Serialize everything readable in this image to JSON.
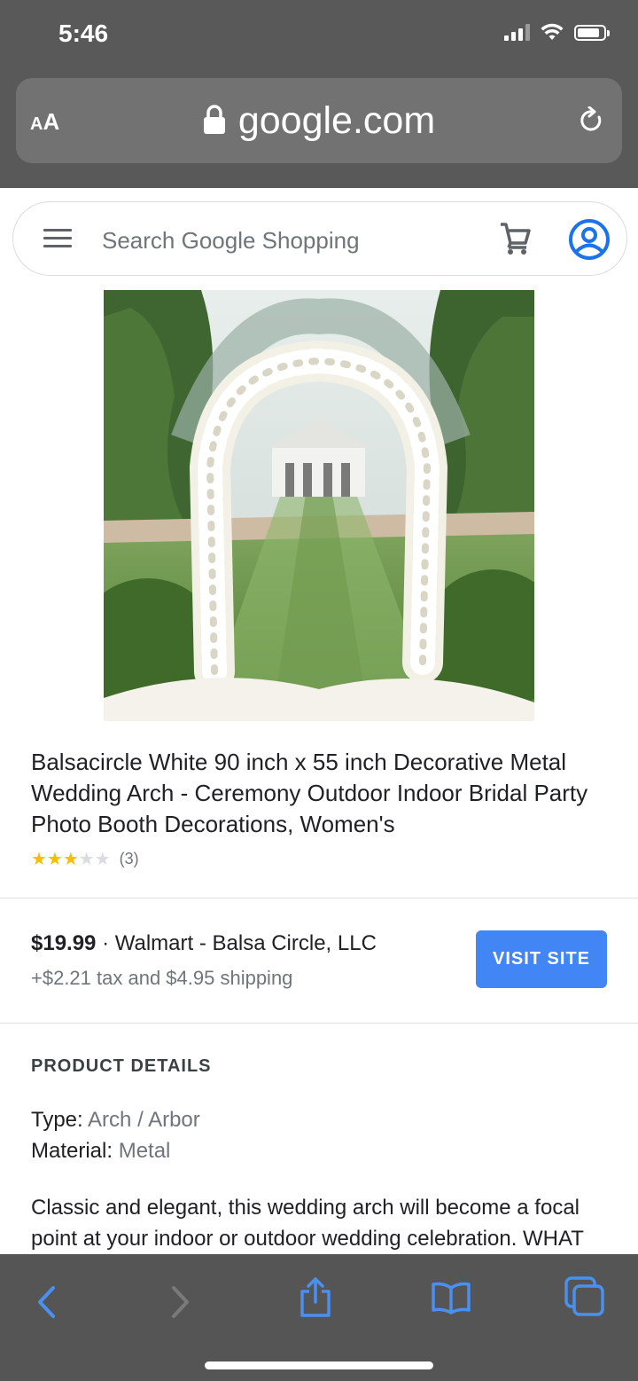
{
  "status_bar": {
    "time": "5:46"
  },
  "browser": {
    "aa_small": "A",
    "aa_big": "A",
    "domain": "google.com"
  },
  "search": {
    "placeholder": "Search Google Shopping"
  },
  "product": {
    "title": "Balsacircle White 90 inch x 55 inch Decorative Metal Wedding Arch - Ceremony Outdoor Indoor Bridal Party Photo Booth Decorations, Women's",
    "rating": 3,
    "rating_max": 5,
    "stars_filled": "★★★",
    "stars_empty": "★★",
    "review_count": "(3)"
  },
  "offer": {
    "price": "$19.99",
    "separator": " · ",
    "seller": "Walmart - Balsa Circle, LLC",
    "shipping": "+$2.21 tax and $4.95 shipping",
    "visit_label": "VISIT SITE",
    "accent_color": "#4285f4"
  },
  "details": {
    "heading": "PRODUCT DETAILS",
    "type_label": "Type:",
    "type_value": "Arch / Arbor",
    "material_label": "Material:",
    "material_value": "Metal",
    "description": "Classic and elegant, this wedding arch will become a focal point at your indoor or outdoor wedding celebration. WHAT"
  },
  "toolbar": {
    "icons": [
      "back-icon",
      "forward-icon",
      "share-icon",
      "bookmarks-icon",
      "tabs-icon"
    ],
    "icon_color": "#4a90f0"
  }
}
